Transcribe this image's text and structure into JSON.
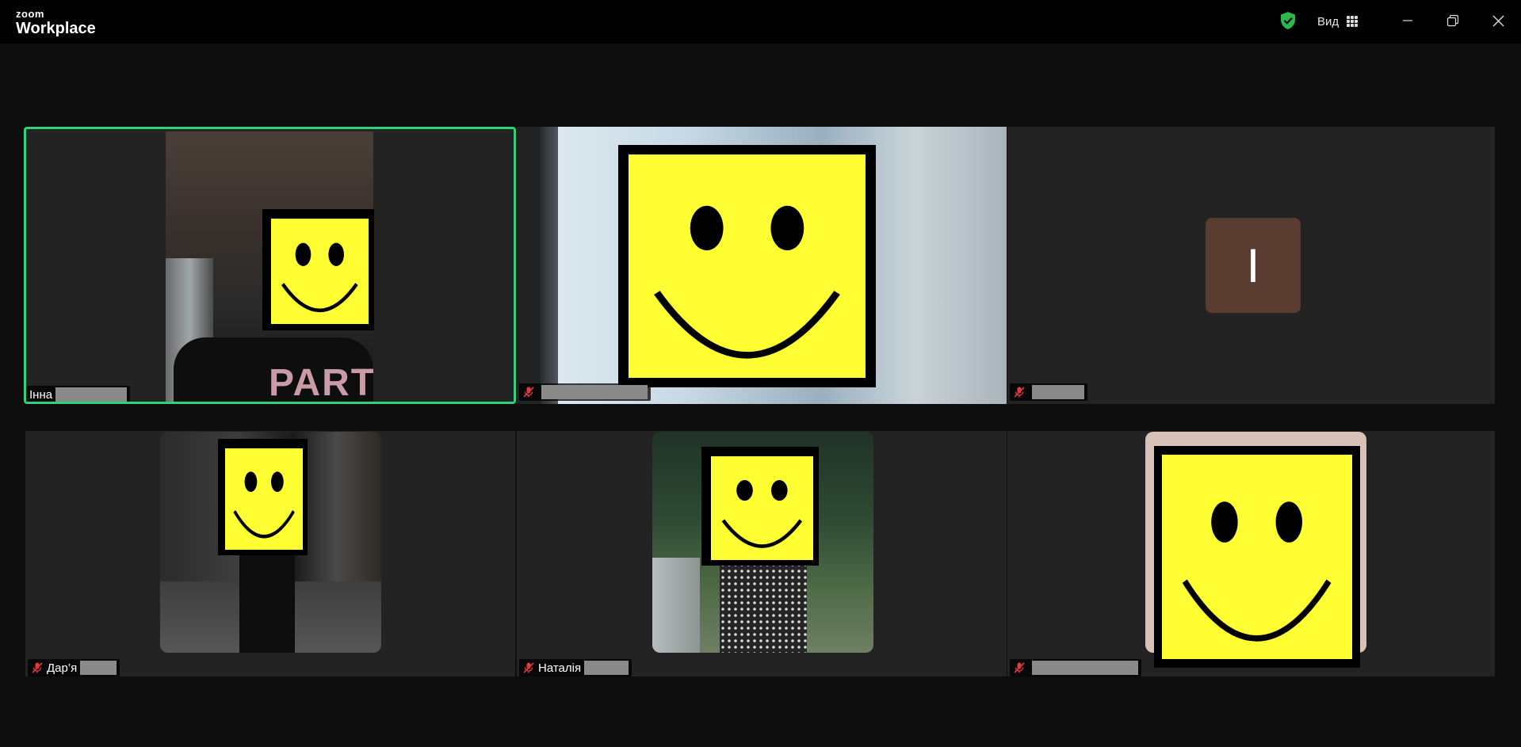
{
  "app": {
    "brand_small": "zoom",
    "brand_big": "Workplace",
    "view_label": "Вид"
  },
  "colors": {
    "active_speaker_border": "#2fd27a",
    "shield": "#2db84d",
    "avatar_bg": "#5a3c30",
    "smiley_yellow": "#ffff33"
  },
  "participants": [
    {
      "name": "Інна",
      "muted": false,
      "active": true,
      "video": true
    },
    {
      "name": "",
      "muted": true,
      "active": false,
      "video": true
    },
    {
      "name": "",
      "muted": true,
      "active": false,
      "video": false,
      "avatar_initial": "I"
    },
    {
      "name": "Дар’я",
      "muted": true,
      "active": false,
      "video": true
    },
    {
      "name": "Наталія",
      "muted": true,
      "active": false,
      "video": true
    },
    {
      "name": "",
      "muted": true,
      "active": false,
      "video": true
    }
  ]
}
